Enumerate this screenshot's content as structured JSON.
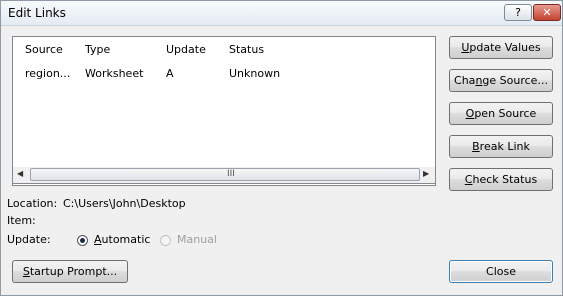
{
  "window": {
    "title": "Edit Links",
    "help_glyph": "?",
    "close_glyph": "✕"
  },
  "links_table": {
    "columns": [
      "Source",
      "Type",
      "Update",
      "Status"
    ],
    "rows": [
      {
        "source": "region...",
        "type": "Worksheet",
        "update": "A",
        "status": "Unknown"
      }
    ],
    "scroll_grip": "III"
  },
  "side_buttons": {
    "update_values": {
      "pre": "",
      "ul": "U",
      "post": "pdate Values"
    },
    "change_source": {
      "pre": "Cha",
      "ul": "n",
      "post": "ge Source..."
    },
    "open_source": {
      "pre": "",
      "ul": "O",
      "post": "pen Source"
    },
    "break_link": {
      "pre": "",
      "ul": "B",
      "post": "reak Link"
    },
    "check_status": {
      "pre": "",
      "ul": "C",
      "post": "heck Status"
    }
  },
  "details": {
    "location_label": "Location:",
    "location_value": "C:\\Users\\John\\Desktop",
    "item_label": "Item:",
    "item_value": "",
    "update_label": "Update:",
    "automatic": {
      "pre": "",
      "ul": "A",
      "post": "utomatic",
      "selected": true
    },
    "manual": {
      "label": "Manual",
      "enabled": false
    }
  },
  "bottom_buttons": {
    "startup_prompt": {
      "pre": "",
      "ul": "S",
      "post": "tartup Prompt..."
    },
    "close": "Close"
  }
}
